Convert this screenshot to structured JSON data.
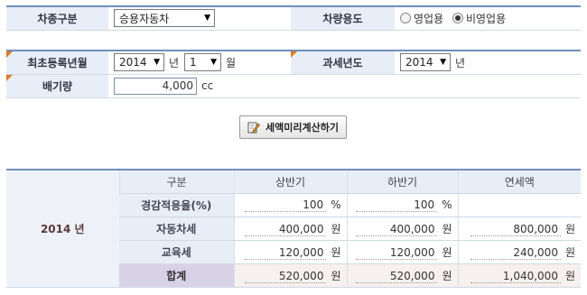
{
  "form": {
    "vehicle_type_label": "차종구분",
    "vehicle_type_value": "승용자동차",
    "vehicle_use_label": "차량용도",
    "use_options": [
      {
        "label": "영업용",
        "selected": false
      },
      {
        "label": "비영업용",
        "selected": true
      }
    ],
    "first_reg_label": "최초등록년월",
    "first_reg_year": "2014",
    "year_unit": "년",
    "first_reg_month": "1",
    "month_unit": "월",
    "tax_year_label": "과세년도",
    "tax_year_value": "2014",
    "tax_year_unit": "년",
    "displacement_label": "배기량",
    "displacement_value": "4,000",
    "displacement_unit": "cc"
  },
  "button": {
    "calc_label": "세액미리계산하기"
  },
  "result": {
    "year_label": "2014 년",
    "headers": [
      "구분",
      "상반기",
      "하반기",
      "연세액"
    ],
    "rows": [
      {
        "label": "경감적용율(%)",
        "first": "100",
        "first_unit": "%",
        "second": "100",
        "second_unit": "%",
        "annual": "",
        "annual_unit": ""
      },
      {
        "label": "자동차세",
        "first": "400,000",
        "first_unit": "원",
        "second": "400,000",
        "second_unit": "원",
        "annual": "800,000",
        "annual_unit": "원"
      },
      {
        "label": "교육세",
        "first": "120,000",
        "first_unit": "원",
        "second": "120,000",
        "second_unit": "원",
        "annual": "240,000",
        "annual_unit": "원"
      },
      {
        "label": "합계",
        "first": "520,000",
        "first_unit": "원",
        "second": "520,000",
        "second_unit": "원",
        "annual": "1,040,000",
        "annual_unit": "원"
      }
    ]
  },
  "colors": {
    "label_bg": "#e8eef7",
    "border_accent": "#6f8eba",
    "corner_marker": "#e07a1f",
    "total_label_bg": "#d9d2e6"
  }
}
